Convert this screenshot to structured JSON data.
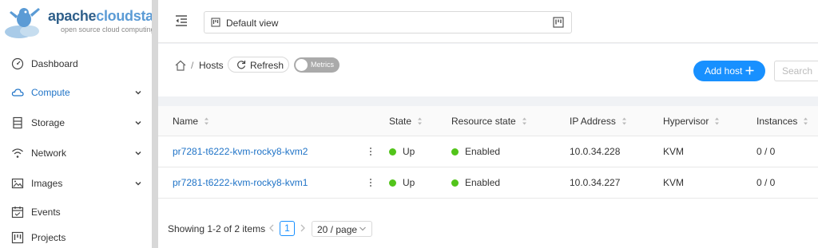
{
  "brand": {
    "name_part1": "apache",
    "name_part2": "cloudstack",
    "tagline": "open source cloud computing"
  },
  "sidebar": {
    "items": [
      {
        "label": "Dashboard",
        "icon": "dashboard-icon",
        "expandable": false,
        "active": false
      },
      {
        "label": "Compute",
        "icon": "cloud-icon",
        "expandable": true,
        "active": true
      },
      {
        "label": "Storage",
        "icon": "database-icon",
        "expandable": true,
        "active": false
      },
      {
        "label": "Network",
        "icon": "wifi-icon",
        "expandable": true,
        "active": false
      },
      {
        "label": "Images",
        "icon": "picture-icon",
        "expandable": true,
        "active": false
      },
      {
        "label": "Events",
        "icon": "schedule-icon",
        "expandable": false,
        "active": false
      },
      {
        "label": "Projects",
        "icon": "project-icon",
        "expandable": false,
        "active": false
      }
    ]
  },
  "header": {
    "view_select_label": "Default view"
  },
  "toolbar": {
    "breadcrumb_separator": "/",
    "breadcrumb_current": "Hosts",
    "refresh_label": "Refresh",
    "metrics_label": "Metrics",
    "add_host_label": "Add host",
    "search_placeholder": "Search"
  },
  "table": {
    "columns": [
      "Name",
      "State",
      "Resource state",
      "IP Address",
      "Hypervisor",
      "Instances"
    ],
    "rows": [
      {
        "name": "pr7281-t6222-kvm-rocky8-kvm2",
        "state": "Up",
        "resource_state": "Enabled",
        "ip": "10.0.34.228",
        "hypervisor": "KVM",
        "instances": "0 / 0"
      },
      {
        "name": "pr7281-t6222-kvm-rocky8-kvm1",
        "state": "Up",
        "resource_state": "Enabled",
        "ip": "10.0.34.227",
        "hypervisor": "KVM",
        "instances": "0 / 0"
      }
    ]
  },
  "pagination": {
    "total_text": "Showing 1-2 of 2 items",
    "current_page": "1",
    "page_size": "20 / page"
  },
  "colors": {
    "primary": "#1890ff",
    "link": "#1f73c7",
    "status_green": "#52c41a"
  }
}
